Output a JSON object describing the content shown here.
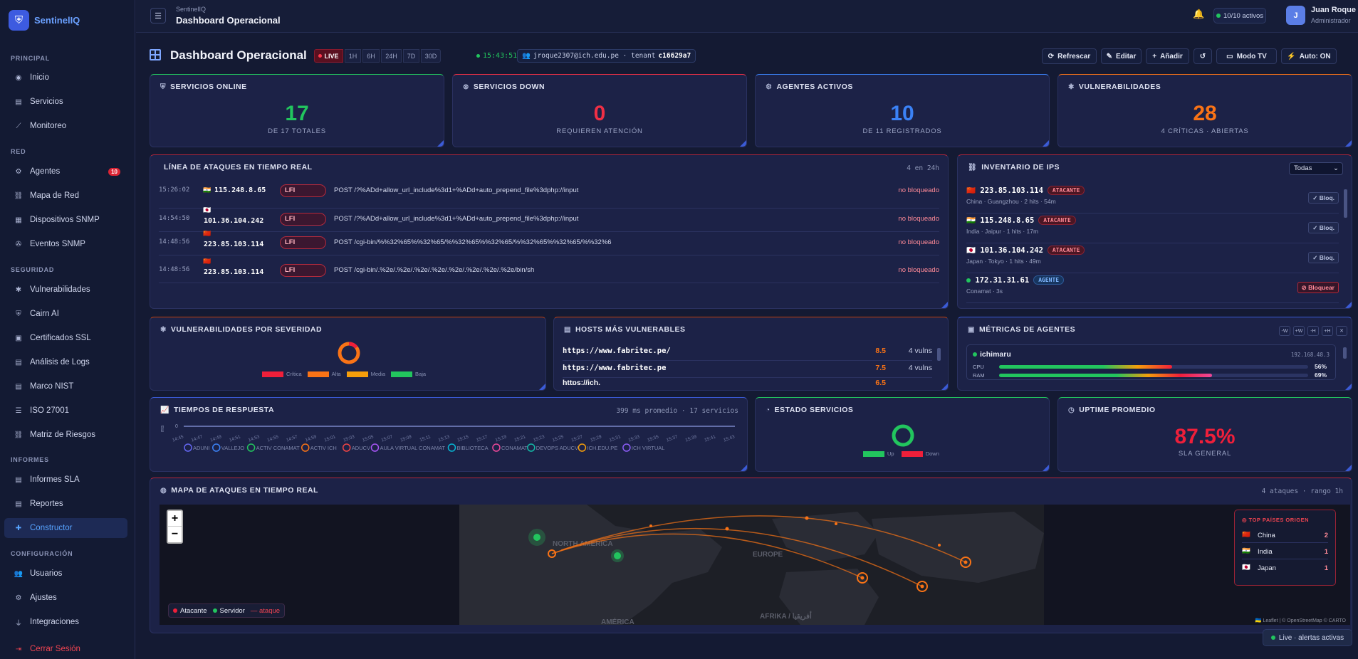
{
  "brand": {
    "name": "SentinelIQ",
    "logo_icon": "shield-icon"
  },
  "sidebar": {
    "sections": [
      {
        "label": "PRINCIPAL",
        "items": [
          {
            "label": "Inicio",
            "icon": "gauge-icon"
          },
          {
            "label": "Servicios",
            "icon": "server-icon"
          },
          {
            "label": "Monitoreo",
            "icon": "chart-line-icon"
          }
        ]
      },
      {
        "label": "RED",
        "items": [
          {
            "label": "Agentes",
            "icon": "robot-icon",
            "badge": "10"
          },
          {
            "label": "Mapa de Red",
            "icon": "network-icon"
          },
          {
            "label": "Dispositivos SNMP",
            "icon": "device-icon"
          },
          {
            "label": "Eventos SNMP",
            "icon": "satellite-icon"
          }
        ]
      },
      {
        "label": "SEGURIDAD",
        "items": [
          {
            "label": "Vulnerabilidades",
            "icon": "bug-icon"
          },
          {
            "label": "Cairn AI",
            "icon": "shield-ai-icon"
          },
          {
            "label": "Certificados SSL",
            "icon": "certificate-icon"
          },
          {
            "label": "Análisis de Logs",
            "icon": "log-icon"
          },
          {
            "label": "Marco NIST",
            "icon": "document-icon"
          },
          {
            "label": "ISO 27001",
            "icon": "list-icon"
          },
          {
            "label": "Matriz de Riesgos",
            "icon": "matrix-icon"
          }
        ]
      },
      {
        "label": "INFORMES",
        "items": [
          {
            "label": "Informes SLA",
            "icon": "file-icon"
          },
          {
            "label": "Reportes",
            "icon": "report-icon"
          },
          {
            "label": "Constructor",
            "icon": "puzzle-icon",
            "active": true
          }
        ]
      },
      {
        "label": "CONFIGURACIÓN",
        "items": [
          {
            "label": "Usuarios",
            "icon": "users-icon"
          },
          {
            "label": "Ajustes",
            "icon": "gear-icon"
          },
          {
            "label": "Integraciones",
            "icon": "plug-icon"
          }
        ]
      }
    ],
    "logout": "Cerrar Sesión"
  },
  "topbar": {
    "crumb_app": "SentinelIQ",
    "crumb_page": "Dashboard Operacional",
    "agents_active": "10/10 activos",
    "user_initial": "J",
    "user_name": "Juan Roque",
    "user_role": "Administrador"
  },
  "header": {
    "title": "Dashboard Operacional",
    "ranges": [
      "LIVE",
      "1H",
      "6H",
      "24H",
      "7D",
      "30D"
    ],
    "clock": "15:43:51",
    "tenant_email": "jroque2307@ich.edu.pe · tenant",
    "tenant_id": "c16629a7",
    "buttons": {
      "refresh": "Refrescar",
      "edit": "Editar",
      "add": "Añadir",
      "mode_tv": "Modo TV",
      "auto": "Auto:  ON"
    }
  },
  "kpis": [
    {
      "title": "SERVICIOS ONLINE",
      "icon": "shield-icon",
      "value": "17",
      "sub": "DE 17 TOTALES",
      "color": "#22c55e"
    },
    {
      "title": "SERVICIOS DOWN",
      "icon": "x-circle-icon",
      "value": "0",
      "sub": "REQUIEREN ATENCIÓN",
      "color": "#ef2f45"
    },
    {
      "title": "AGENTES ACTIVOS",
      "icon": "robot-icon",
      "value": "10",
      "sub": "DE 11 REGISTRADOS",
      "color": "#3b82f6"
    },
    {
      "title": "VULNERABILIDADES",
      "icon": "bug-icon",
      "value": "28",
      "sub": "4 CRÍTICAS · ABIERTAS",
      "color": "#f97316"
    }
  ],
  "attacks": {
    "title": "LÍNEA DE ATAQUES EN TIEMPO REAL",
    "note": "4 en 24h",
    "rows": [
      {
        "time": "15:26:02",
        "flag": "🇮🇳",
        "ip": "115.248.8.65",
        "type": "LFI",
        "payload": "POST /?%ADd+allow_url_include%3d1+%ADd+auto_prepend_file%3dphp://input",
        "status": "no bloqueado"
      },
      {
        "time": "14:54:50",
        "flag": "🇯🇵",
        "ip": "101.36.104.242",
        "type": "LFI",
        "payload": "POST /?%ADd+allow_url_include%3d1+%ADd+auto_prepend_file%3dphp://input",
        "status": "no bloqueado"
      },
      {
        "time": "14:48:56",
        "flag": "🇨🇳",
        "ip": "223.85.103.114",
        "type": "LFI",
        "payload": "POST /cgi-bin/%%32%65%%32%65/%%32%65%%32%65/%%32%65%%32%65/%%32%6",
        "status": "no bloqueado"
      },
      {
        "time": "14:48:56",
        "flag": "🇨🇳",
        "ip": "223.85.103.114",
        "type": "LFI",
        "payload": "POST /cgi-bin/.%2e/.%2e/.%2e/.%2e/.%2e/.%2e/.%2e/.%2e/bin/sh",
        "status": "no bloqueado"
      }
    ]
  },
  "ip_inventory": {
    "title": "INVENTARIO DE IPS",
    "filter": "Todas",
    "rows": [
      {
        "flag": "🇨🇳",
        "ip": "223.85.103.114",
        "badge": "ATACANTE",
        "sub": "China · Guangzhou · 2 hits · 54m",
        "action": "✓ Bloq."
      },
      {
        "flag": "🇮🇳",
        "ip": "115.248.8.65",
        "badge": "ATACANTE",
        "sub": "India · Jaipur · 1 hits · 17m",
        "action": "✓ Bloq."
      },
      {
        "flag": "🇯🇵",
        "ip": "101.36.104.242",
        "badge": "ATACANTE",
        "sub": "Japan · Tokyo · 1 hits · 49m",
        "action": "✓ Bloq."
      },
      {
        "flag": "",
        "ip": "172.31.31.61",
        "badge": "AGENTE",
        "sub": "Conamat · 3s",
        "action": "⊘ Bloquear"
      }
    ]
  },
  "vuln_severity": {
    "title": "VULNERABILIDADES POR SEVERIDAD",
    "legend": [
      "Crítica",
      "Alta",
      "Media",
      "Baja"
    ],
    "colors": [
      "#ef1f3a",
      "#f97316",
      "#f59e0b",
      "#22c55e"
    ]
  },
  "hosts": {
    "title": "HOSTS MÁS VULNERABLES",
    "rows": [
      {
        "url": "https://www.fabritec.pe/",
        "score": "8.5",
        "vulns": "4 vulns"
      },
      {
        "url": "https://www.fabritec.pe",
        "score": "7.5",
        "vulns": "4 vulns"
      }
    ]
  },
  "agent_metrics": {
    "title": "MÉTRICAS DE AGENTES",
    "controls": [
      "-W",
      "+W",
      "-H",
      "+H",
      "✕"
    ],
    "agent": "ichimaru",
    "ip": "192.168.48.3",
    "cpu_label": "CPU",
    "cpu": "56%",
    "ram_label": "RAM",
    "ram": "69%",
    "cpu_frac": 0.56,
    "ram_frac": 0.69
  },
  "response": {
    "title": "TIEMPOS DE RESPUESTA",
    "note": "399 ms promedio · 17 servicios",
    "yunit": "ms",
    "ytick": "0",
    "xticks": [
      "14:45",
      "14:47",
      "14:49",
      "14:51",
      "14:53",
      "14:55",
      "14:57",
      "14:59",
      "15:01",
      "15:03",
      "15:05",
      "15:07",
      "15:09",
      "15:11",
      "15:13",
      "15:15",
      "15:17",
      "15:19",
      "15:21",
      "15:23",
      "15:25",
      "15:27",
      "15:29",
      "15:31",
      "15:33",
      "15:35",
      "15:37",
      "15:39",
      "15:41",
      "15:43"
    ],
    "series": [
      {
        "name": "ADUNI",
        "color": "#6366f1"
      },
      {
        "name": "VALLEJO",
        "color": "#3b82f6"
      },
      {
        "name": "ACTIV CONAMAT",
        "color": "#22c55e"
      },
      {
        "name": "ACTIV ICH",
        "color": "#f97316"
      },
      {
        "name": "ADUCV",
        "color": "#ef4444"
      },
      {
        "name": "AULA VIRTUAL CONAMAT",
        "color": "#a855f7"
      },
      {
        "name": "BIBLIOTECA",
        "color": "#06b6d4"
      },
      {
        "name": "CONAMAT",
        "color": "#ec4899"
      },
      {
        "name": "DEVOPS ADUCV",
        "color": "#14b8a6"
      },
      {
        "name": "ICH.EDU.PE",
        "color": "#f59e0b"
      },
      {
        "name": "ICH VIRTUAL",
        "color": "#8b5cf6"
      }
    ]
  },
  "estado": {
    "title": "ESTADO SERVICIOS",
    "legend": [
      "Up",
      "Down"
    ],
    "colors": [
      "#22c55e",
      "#ef1f3a"
    ],
    "up": 17,
    "down": 0
  },
  "uptime": {
    "title": "UPTIME PROMEDIO",
    "value": "87.5%",
    "sub": "SLA GENERAL"
  },
  "attack_map": {
    "title": "MAPA DE ATAQUES EN TIEMPO REAL",
    "note": "4 ataques · rango 1h",
    "labels": [
      "NORTH AMERICA",
      "EUROPE",
      "AFRIKA / أفريقيا",
      "AMÉRICA"
    ],
    "legend": {
      "attacker": "Atacante",
      "server": "Servidor",
      "attack": "— ataque"
    },
    "top_title": "TOP PAÍSES ORIGEN",
    "top": [
      {
        "flag": "🇨🇳",
        "country": "China",
        "count": "2"
      },
      {
        "flag": "🇮🇳",
        "country": "India",
        "count": "1"
      },
      {
        "flag": "🇯🇵",
        "country": "Japan",
        "count": "1"
      }
    ],
    "attribution": "🇺🇦 Leaflet | © OpenStreetMap © CARTO"
  },
  "toast": "Live · alertas activas"
}
